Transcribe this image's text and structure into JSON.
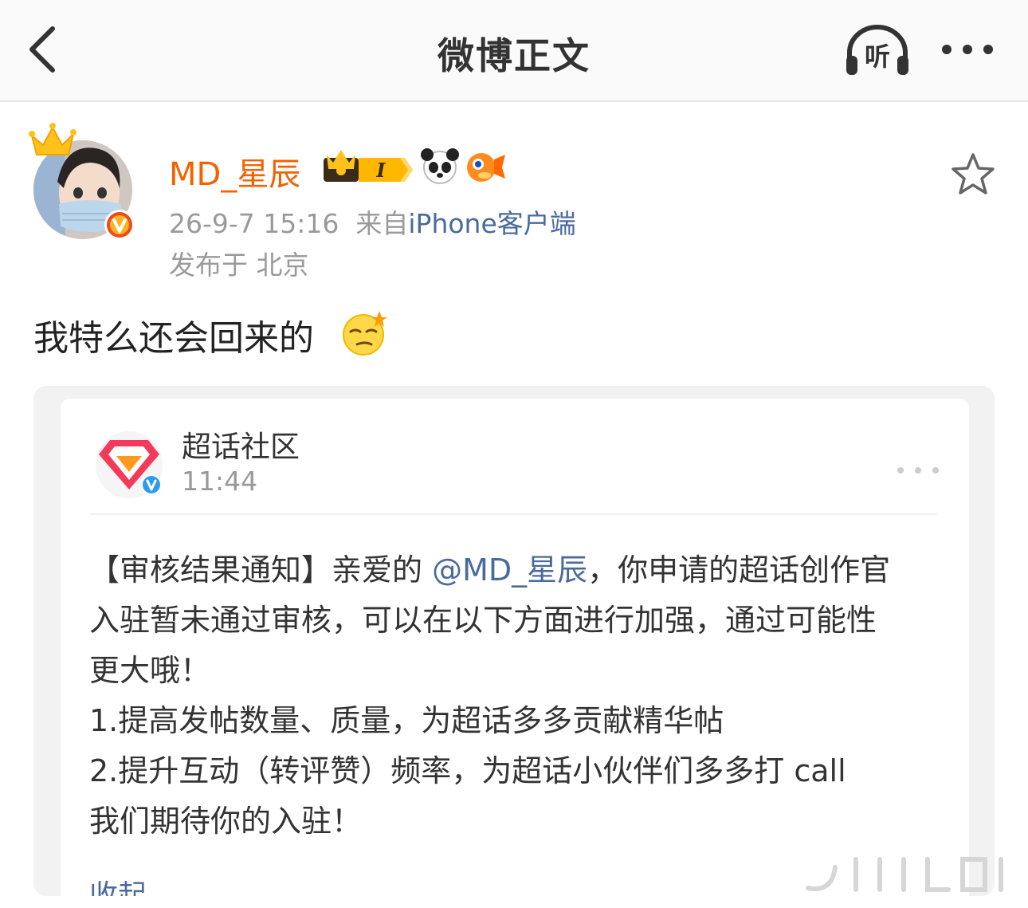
{
  "nav": {
    "title": "微博正文",
    "listen_label": "听"
  },
  "post": {
    "author": "MD_星辰",
    "time": "26-9-7 15:16",
    "source_prefix": "来自",
    "source": "iPhone客户端",
    "location": "发布于 北京",
    "text": "我特么还会回来的",
    "member_level": "I"
  },
  "quote": {
    "author": "超话社区",
    "time": "11:44",
    "body": {
      "line1_a": "【审核结果通知】亲爱的 ",
      "mention": "@MD_星辰",
      "line1_b": "，你申请的超话创作官",
      "line2": "入驻暂未通过审核，可以在以下方面进行加强，通过可能性",
      "line3": "更大哦！",
      "line4": "1.提高发帖数量、质量，为超话多多贡献精华帖",
      "line5": "2.提升互动（转评赞）频率，为超话小伙伴们多多打 call",
      "line6": "我们期待你的入驻！"
    },
    "collapse_label": "收起"
  },
  "colors": {
    "username": "#f46200",
    "link": "#4a6a9c",
    "meta": "#9a9a9a"
  },
  "icons": [
    "back-icon",
    "listen-icon",
    "more-icon",
    "star-icon",
    "crown-icon",
    "verified-icon",
    "panda-icon",
    "pufferfish-icon",
    "emoji-smirk-icon",
    "supertopic-logo-icon",
    "more-dots-icon"
  ]
}
